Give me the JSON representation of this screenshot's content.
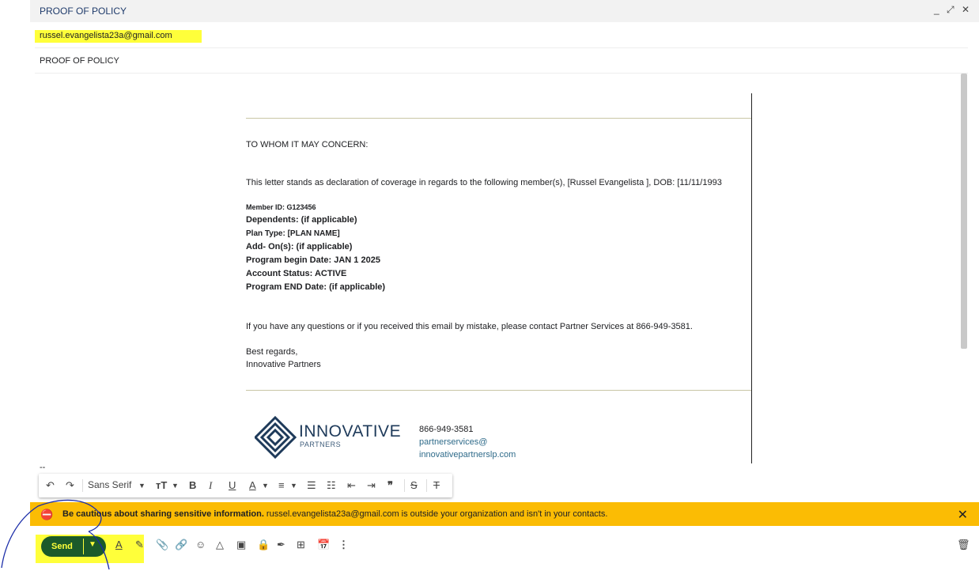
{
  "window": {
    "title": "PROOF OF POLICY",
    "controls": [
      "_",
      "⤢",
      "✕"
    ]
  },
  "recipient": "russel.evangelista23a@gmail.com",
  "subject": "PROOF OF POLICY",
  "letter": {
    "salutation": "TO WHOM IT MAY CONCERN:",
    "intro": "This letter stands as declaration of coverage in regards to the following member(s), [Russel Evangelista ], DOB:  [11/11/1993",
    "fields": [
      {
        "label": "Member ID: G123456"
      },
      {
        "label": "Dependents: (if applicable)"
      },
      {
        "label": "Plan Type:  [PLAN NAME]"
      },
      {
        "label": "Add- On(s): (if applicable)"
      },
      {
        "label": "Program begin Date:  JAN 1 2025"
      },
      {
        "label": "Account Status: ACTIVE"
      },
      {
        "label": "Program END Date: (if applicable)"
      }
    ],
    "questions": "If you have any questions or if you received this email by mistake, please contact Partner Services at 866-949-3581.",
    "closing": "Best regards,",
    "signature": "Innovative Partners"
  },
  "logo": {
    "name": "INNOVATIVE",
    "sub": "PARTNERS"
  },
  "contact": {
    "phone": "866-949-3581",
    "email_line1": "partnerservices@",
    "email_line2": "innovativepartnerslp.com"
  },
  "signature_dashes": "--",
  "format_toolbar": {
    "font": "Sans Serif"
  },
  "warning": {
    "bold": "Be cautious about sharing sensitive information.",
    "rest": " russel.evangelista23a@gmail.com is outside your organization and isn't in your contacts."
  },
  "send_label": "Send",
  "colors": {
    "warning_bg": "#fbbc04",
    "highlight": "#ffff3a",
    "send_bg": "#1b5a2a"
  }
}
